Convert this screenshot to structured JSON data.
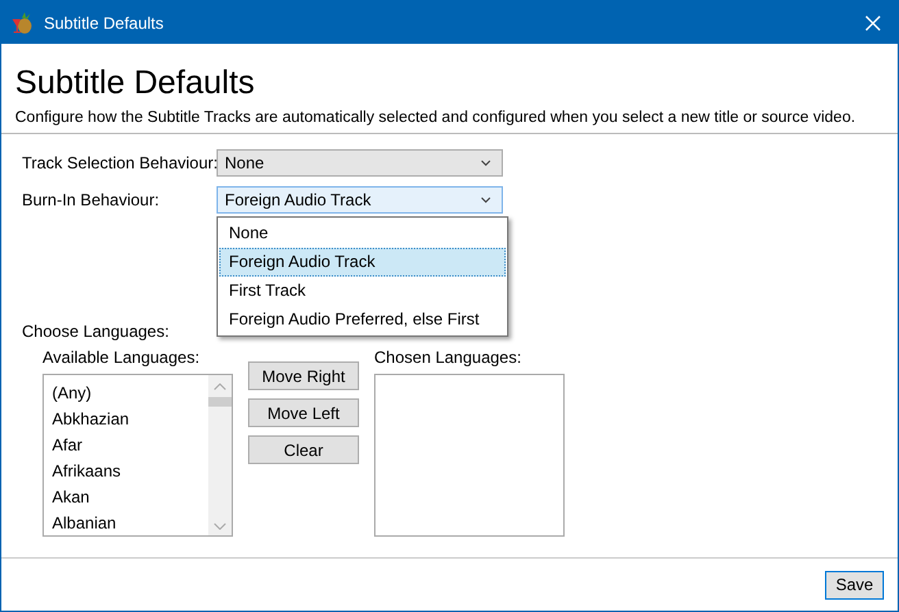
{
  "window": {
    "title": "Subtitle Defaults"
  },
  "heading": "Subtitle Defaults",
  "description": "Configure how the Subtitle Tracks are automatically selected and configured when you select a new title or source video.",
  "fields": [
    {
      "label": "Track Selection Behaviour:",
      "value": "None",
      "focused": false
    },
    {
      "label": "Burn-In Behaviour:",
      "value": "Foreign Audio Track",
      "focused": true
    }
  ],
  "dropdown": {
    "options": [
      {
        "label": "None",
        "selected": false
      },
      {
        "label": "Foreign Audio Track",
        "selected": true
      },
      {
        "label": "First Track",
        "selected": false
      },
      {
        "label": "Foreign Audio Preferred, else First",
        "selected": false
      }
    ]
  },
  "languages": {
    "title": "Choose Languages:",
    "available_label": "Available Languages:",
    "available": [
      "(Any)",
      "Abkhazian",
      "Afar",
      "Afrikaans",
      "Akan",
      "Albanian"
    ],
    "chosen_label": "Chosen Languages:",
    "buttons": [
      "Move Right",
      "Move Left",
      "Clear"
    ]
  },
  "footer": {
    "buttons": [
      "Save"
    ]
  }
}
